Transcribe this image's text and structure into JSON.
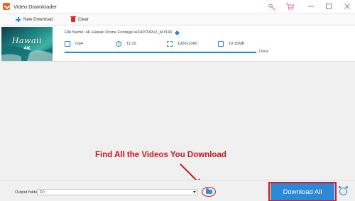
{
  "window": {
    "title": "Video Downloader"
  },
  "toolbar": {
    "new_download": "New Download",
    "clear": "Clear"
  },
  "item": {
    "thumbnail": {
      "title": "Hawaii",
      "subtitle": "4K"
    },
    "file_name": "File Name: 4K Hawaii Drone Footage-w2H07DRv2_M.f140",
    "format": "mp4",
    "duration": "11:10",
    "resolution": "1920x1080",
    "size": "10.15MB",
    "progress": 1.0,
    "status": "Done"
  },
  "annotation": {
    "text": "Find All the Videos You Download"
  },
  "bottom": {
    "output_label": "Output folder:",
    "output_path": "D:\\",
    "download_all": "Download All"
  },
  "colors": {
    "accent": "#2a89d8",
    "highlight": "#d7141a",
    "brand": "#e8641c"
  },
  "icons": [
    "app-logo",
    "key-icon",
    "cart-icon",
    "minimize-icon",
    "maximize-icon",
    "close-icon",
    "plus-icon",
    "trash-icon",
    "pencil-icon",
    "format-icon",
    "clock-icon",
    "resolution-icon",
    "folder-icon",
    "alarm-clock-icon"
  ]
}
